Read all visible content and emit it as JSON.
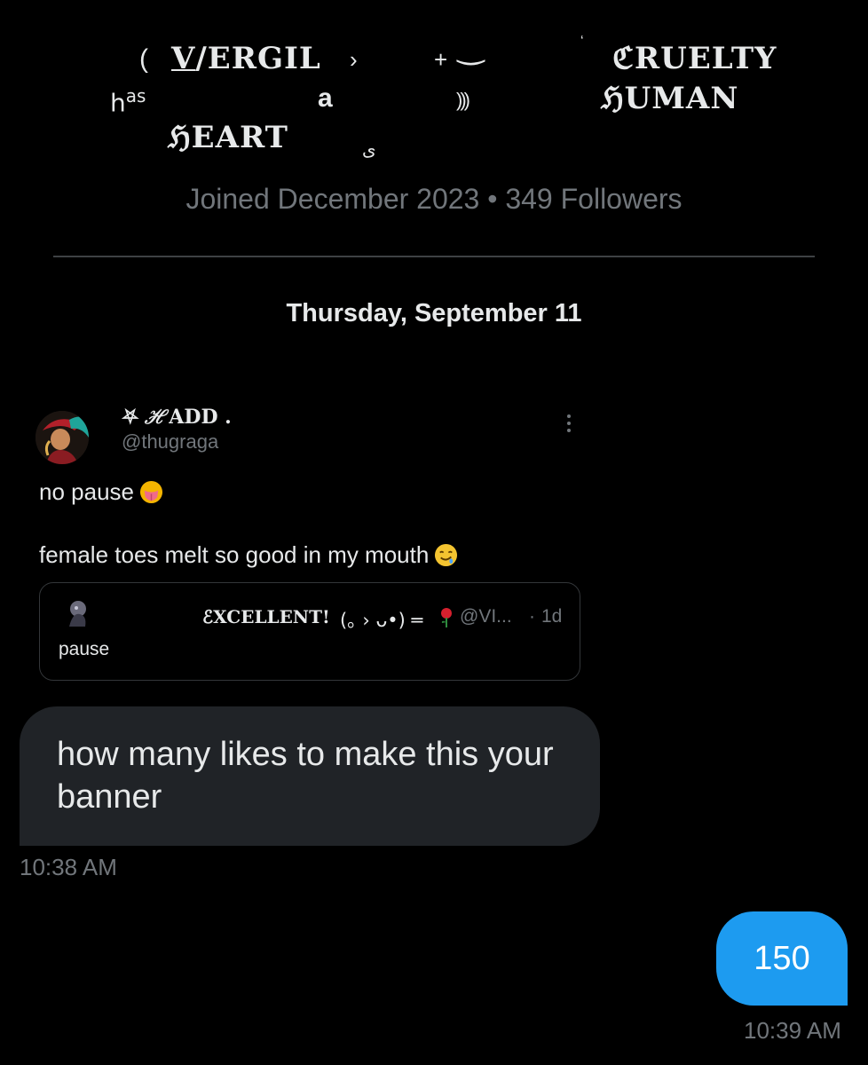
{
  "profile": {
    "banner_fragments": {
      "paren": "(",
      "vergil_v": "V",
      "vergil_rest": "/ERGIL",
      "angle": "›",
      "plus": "+",
      "arc": "‿",
      "tick": "‘",
      "cruelty": "ℭRUELTY",
      "has_h": "h",
      "has_as": "as",
      "a": "a",
      "bars": ")))",
      "human": "ℌUMAN",
      "heart": "ℌEART",
      "s": "ﻯ"
    },
    "meta": "Joined December 2023 • 349 Followers"
  },
  "conversation": {
    "date_separator": "Thursday, September 11",
    "shared_post": {
      "author_name": "⛧ ℋADD .",
      "author_handle": "@thugraga",
      "line1": "no pause",
      "line2": "female toes melt so good in my mouth",
      "quote": {
        "name": "ℰXCELLENT!",
        "kaomoji": "(｡ ›  ᴗ•) ═",
        "handle": "@VI...",
        "dot": "·",
        "time": "1d",
        "text": "pause"
      }
    },
    "incoming": {
      "text": "how many likes to make this your banner",
      "time": "10:38 AM"
    },
    "outgoing": {
      "text": "150",
      "time": "10:39 AM"
    }
  },
  "colors": {
    "background": "#000000",
    "incoming_bubble": "#202327",
    "outgoing_bubble": "#1d9bf0",
    "secondary_text": "#71767b"
  },
  "icons": [
    "tongue-emoji-icon",
    "drooling-emoji-icon",
    "rose-emoji-icon",
    "more-vertical-icon"
  ]
}
